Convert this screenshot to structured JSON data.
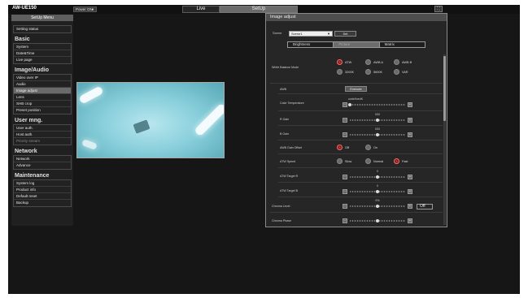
{
  "topbar": {
    "model": "AW-UE150",
    "power": "Power ON",
    "tab_live": "Live",
    "tab_setup": "SetUp",
    "fullscreen_icon": "fullscreen-icon"
  },
  "sidebar": {
    "title": "SetUp Menu",
    "setting_status": "Setting status",
    "sections": [
      {
        "title": "Basic",
        "items": [
          "System",
          "Date&Time",
          "Live page"
        ]
      },
      {
        "title": "Image/Audio",
        "items": [
          "Video over IP",
          "Audio",
          "Image adjust",
          "Lens",
          "SHB crop",
          "Preset position"
        ]
      },
      {
        "title": "User mng.",
        "items": [
          "User auth.",
          "Host auth.",
          "Priority stream"
        ]
      },
      {
        "title": "Network",
        "items": [
          "Network",
          "Advance"
        ]
      },
      {
        "title": "Maintenance",
        "items": [
          "System log",
          "Product info",
          "Default reset",
          "Backup"
        ]
      }
    ],
    "active_item": "Image adjust"
  },
  "panel": {
    "title": "Image adjust",
    "scene_label": "Scene",
    "scene_value": "Scene1",
    "set_label": "Set",
    "tabs": [
      "Brightness",
      "Picture",
      "Matrix"
    ],
    "active_tab": "Picture",
    "rows": {
      "white_balance_mode": {
        "label": "White Balance Mode",
        "options": [
          "ATW",
          "AWB A",
          "AWB B",
          "3200K",
          "5600K",
          "VAR"
        ],
        "selected": "ATW"
      },
      "awb": {
        "label": "AWB",
        "button": "Execute"
      },
      "color_temp": {
        "label": "Color Temperature",
        "value_text": "undefinedK",
        "level": 0.0
      },
      "r_gain": {
        "label": "R Gain",
        "value_text": "000",
        "level": 0.5
      },
      "b_gain": {
        "label": "B Gain",
        "value_text": "000",
        "level": 0.5
      },
      "awb_gain_offset": {
        "label": "AWB Gain Offset",
        "options": [
          "Off",
          "On"
        ],
        "selected": "Off"
      },
      "atw_speed": {
        "label": "ATW Speed",
        "options": [
          "Slow",
          "Normal",
          "Fast"
        ],
        "selected": "Fast"
      },
      "atw_target_r": {
        "label": "ATW Target R",
        "value_text": "0",
        "level": 0.5
      },
      "atw_target_b": {
        "label": "ATW Target B",
        "value_text": "0",
        "level": 0.5
      },
      "chroma_level": {
        "label": "Chroma Level",
        "value_text": "0%",
        "level": 0.5,
        "toggle": "Off"
      },
      "chroma_phase": {
        "label": "Chroma Phase",
        "value_text": "",
        "level": 0.5
      }
    }
  },
  "colors": {
    "radio_on": "#e04040",
    "radio_off": "#6a6a6a",
    "active_menu": "#6a6a6a",
    "background": "#161616"
  }
}
